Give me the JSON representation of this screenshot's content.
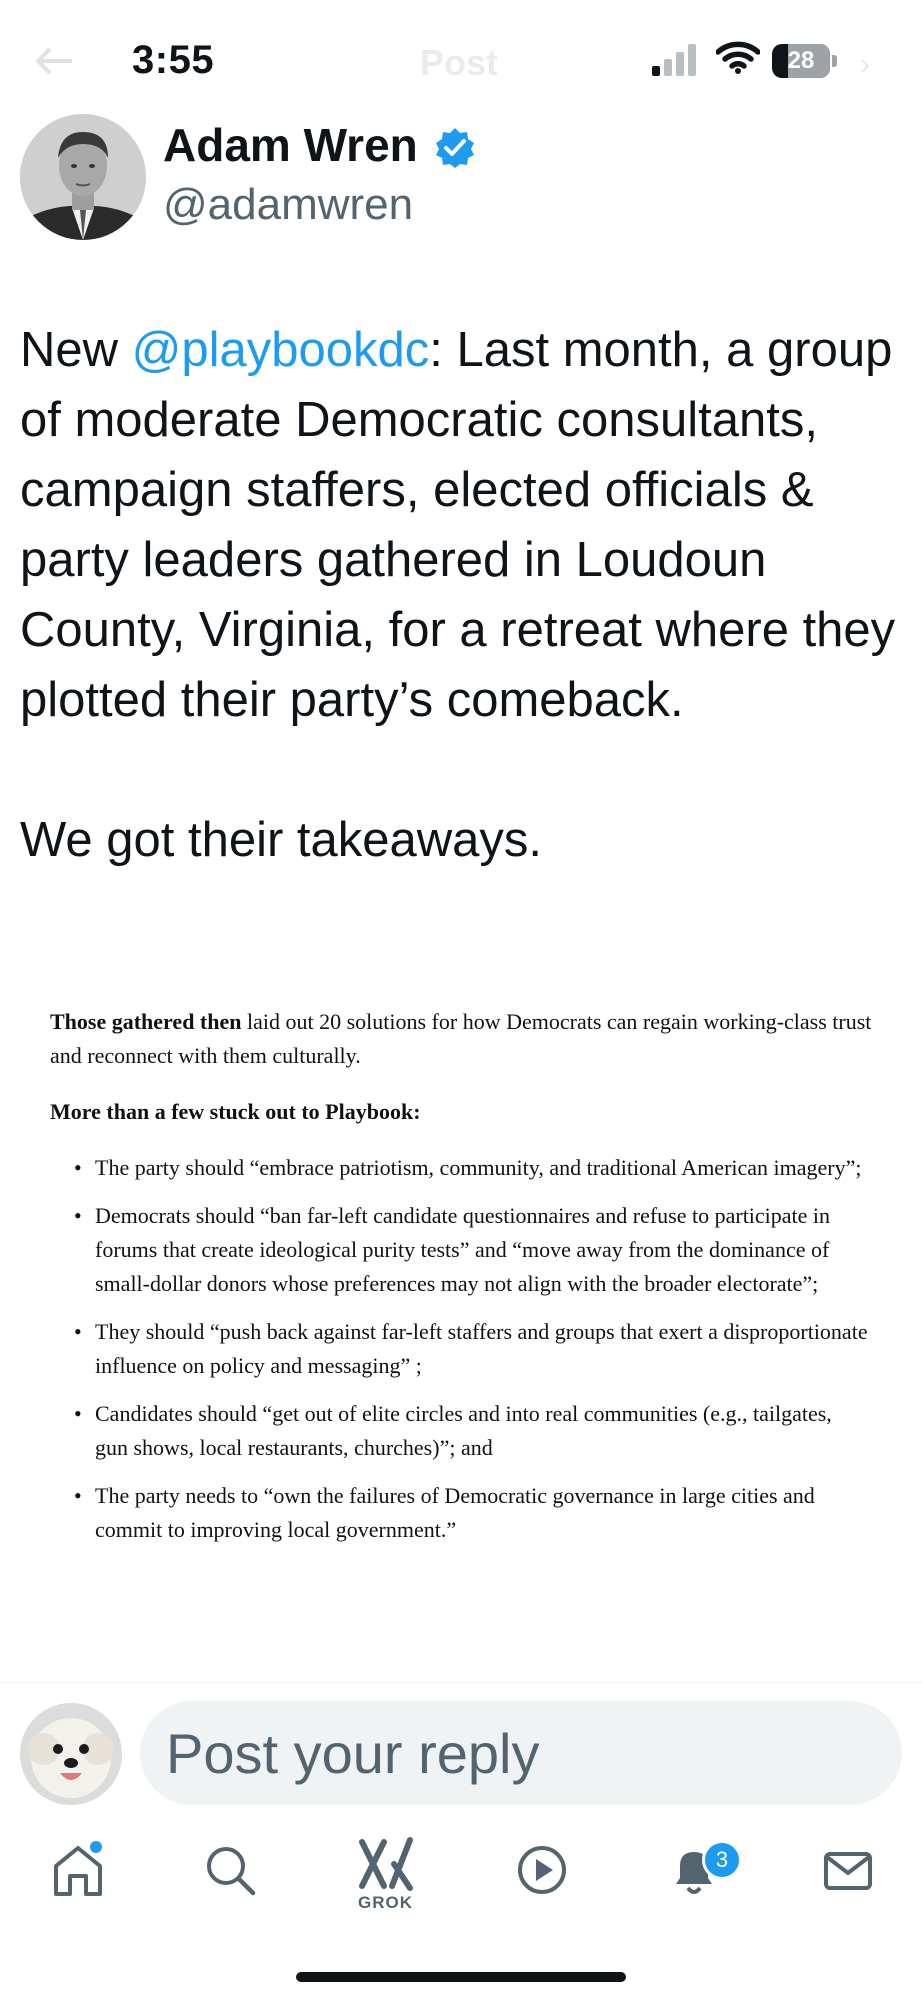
{
  "status_bar": {
    "time": "3:55",
    "battery_level": "28",
    "battery_fraction": 0.28,
    "background_title": "Post",
    "icons": [
      "signal-icon",
      "wifi-icon",
      "battery-icon"
    ]
  },
  "tweet": {
    "author_name": "Adam Wren",
    "author_handle": "@adamwren",
    "verified": true,
    "text_prefix": "New ",
    "mention": "@playbookdc",
    "text_body": ": Last month, a group of moderate Democratic consultants, campaign staffers, elected officials & party leaders gathered in Loudoun County, Virginia, for a retreat where they plotted their party’s comeback.",
    "text_second": "We got their takeaways."
  },
  "article_image": {
    "p1_bold": "Those gathered then",
    "p1_rest": " laid out 20 solutions for how Democrats can regain working-class trust and reconnect with them culturally.",
    "p2": "More than a few stuck out to Playbook:",
    "bullets": [
      "The party should “embrace patriotism, community, and traditional American imagery”;",
      "Democrats should “ban far-left candidate questionnaires and refuse to participate in forums that create ideological purity tests” and “move away from the dominance of small-dollar donors whose preferences may not align with the broader electorate”;",
      "They should “push back against far-left staffers and groups that exert a disproportionate influence on policy and messaging” ;",
      "Candidates should “get out of elite circles and into real communities (e.g., tailgates, gun shows, local restaurants, churches)”; and",
      "The party needs to “own the failures of Democratic governance in large cities and commit to improving local government.”"
    ]
  },
  "reply": {
    "placeholder": "Post your reply"
  },
  "tab_bar": {
    "grok_label": "GROK",
    "notification_count": "3",
    "icons": [
      "home-icon",
      "search-icon",
      "grok-icon",
      "video-icon",
      "notifications-icon",
      "messages-icon"
    ]
  },
  "colors": {
    "accent": "#1d9bf0",
    "text": "#0f1419",
    "secondary": "#536471",
    "input_bg": "#eff3f4"
  }
}
